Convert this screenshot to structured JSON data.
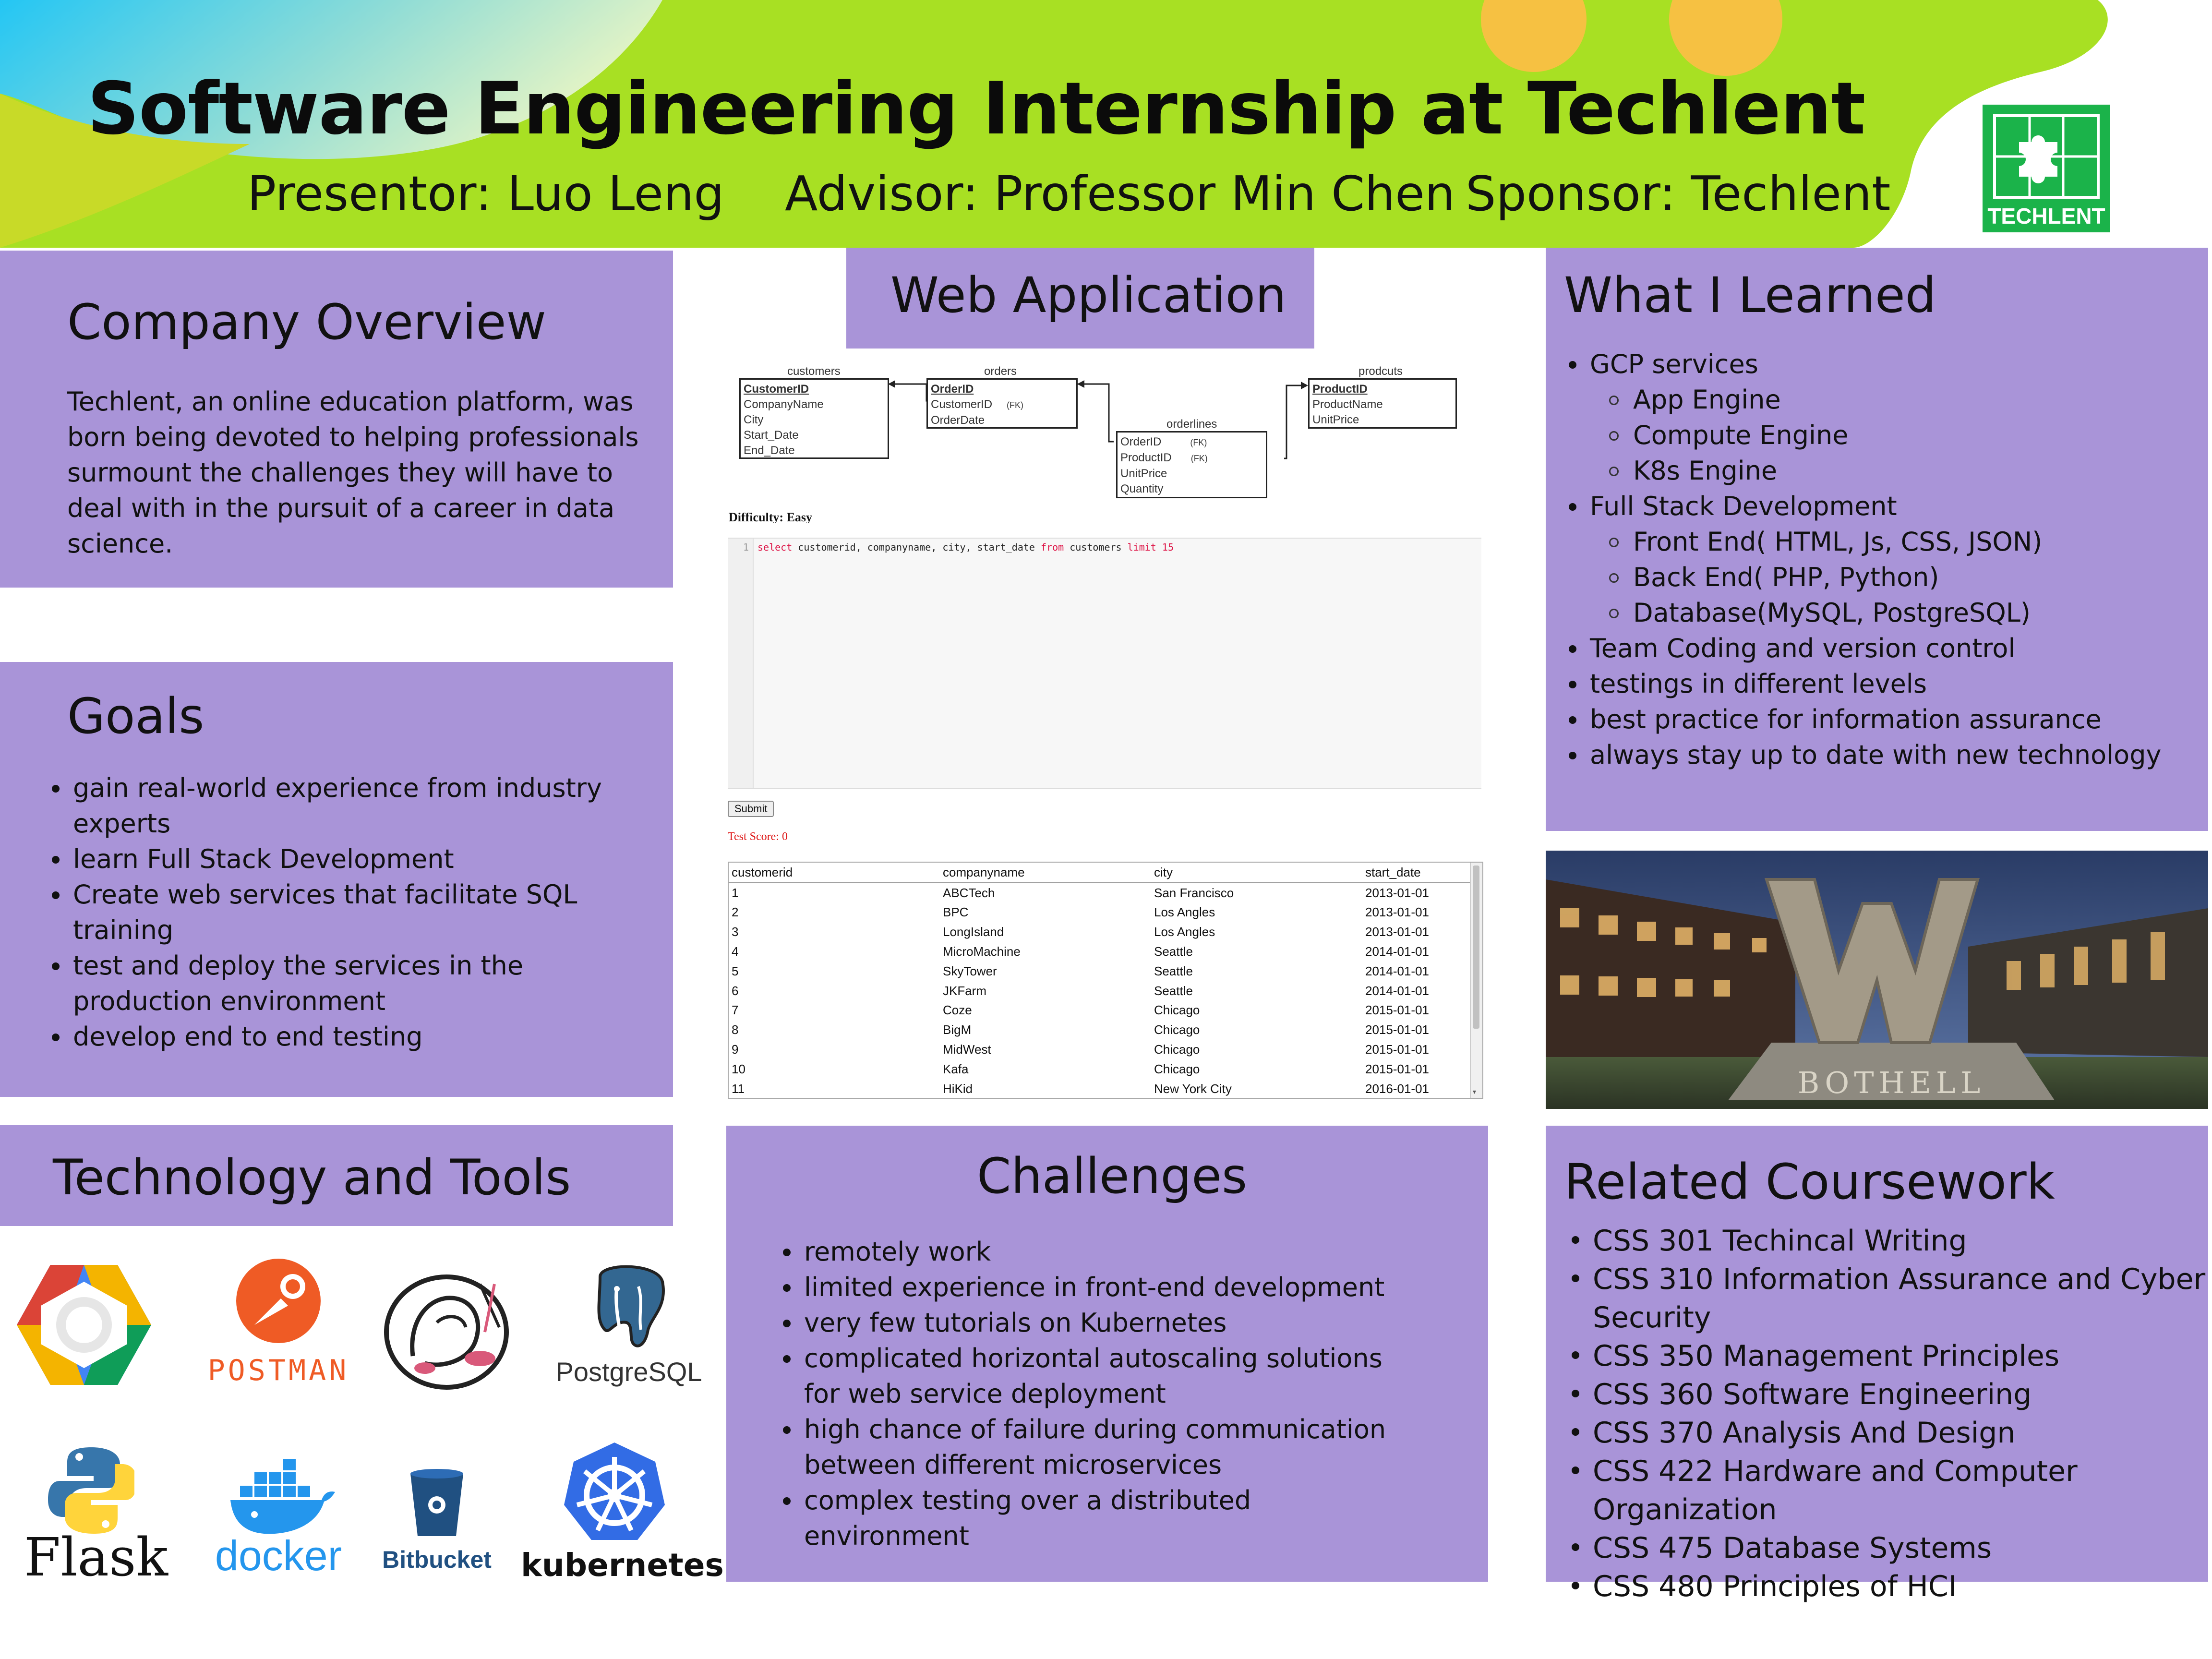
{
  "header": {
    "title": "Software Engineering Internship at Techlent",
    "presenter": "Presentor: Luo Leng",
    "advisor": "Advisor: Professor Min Chen",
    "sponsor": "Sponsor: Techlent",
    "logo_text": "TECHLENT"
  },
  "colors": {
    "panel": "#a994d8",
    "header_green": "#a8e023",
    "header_cyan": "#2ec4f0",
    "logo_green": "#1bb34a"
  },
  "company_overview": {
    "title": "Company Overview",
    "text": "Techlent, an online education platform, was born being devoted to helping professionals surmount the challenges they will have to deal with in the pursuit of a career in data science."
  },
  "goals": {
    "title": "Goals",
    "items": [
      "gain real-world experience from industry experts",
      "learn Full Stack Development",
      "Create web services that facilitate SQL training",
      "test and deploy the services in the production environment",
      "develop end to end testing"
    ]
  },
  "technology": {
    "title": "Technology and Tools",
    "logos": [
      "gcp-icon",
      "postman-icon",
      "sqlalchemy-icon",
      "postgresql-icon",
      "flask-icon",
      "docker-icon",
      "bitbucket-icon",
      "kubernetes-icon"
    ],
    "labels": {
      "postman": "POSTMAN",
      "postgres": "PostgreSQL",
      "flask": "Flask",
      "docker": "docker",
      "bitbucket": "Bitbucket",
      "kubernetes": "kubernetes"
    }
  },
  "web_app": {
    "title": "Web Application",
    "er": {
      "customers": {
        "name": "customers",
        "fields": [
          "CustomerID",
          "CompanyName",
          "City",
          "Start_Date",
          "End_Date"
        ]
      },
      "orders": {
        "name": "orders",
        "fields": [
          "OrderID",
          "CustomerID",
          "OrderDate"
        ]
      },
      "orderlines": {
        "name": "orderlines",
        "fields": [
          "OrderID",
          "ProductID",
          "UnitPrice",
          "Quantity"
        ]
      },
      "products": {
        "name": "prodcuts",
        "fields": [
          "ProductID",
          "ProductName",
          "UnitPrice"
        ]
      },
      "fk": "(FK)"
    },
    "difficulty": "Difficulty: Easy",
    "line_no": "1",
    "sql": {
      "k1": "select",
      "cols": " customerid, companyname, city, start_date ",
      "k2": "from",
      "tbl": " customers ",
      "k3": "limit",
      "num": " 15"
    },
    "submit": "Submit",
    "score": "Test Score: 0",
    "columns": [
      "customerid",
      "companyname",
      "city",
      "start_date"
    ],
    "rows": [
      [
        "1",
        "ABCTech",
        "San Francisco",
        "2013-01-01"
      ],
      [
        "2",
        "BPC",
        "Los Angles",
        "2013-01-01"
      ],
      [
        "3",
        "LongIsland",
        "Los Angles",
        "2013-01-01"
      ],
      [
        "4",
        "MicroMachine",
        "Seattle",
        "2014-01-01"
      ],
      [
        "5",
        "SkyTower",
        "Seattle",
        "2014-01-01"
      ],
      [
        "6",
        "JKFarm",
        "Seattle",
        "2014-01-01"
      ],
      [
        "7",
        "Coze",
        "Chicago",
        "2015-01-01"
      ],
      [
        "8",
        "BigM",
        "Chicago",
        "2015-01-01"
      ],
      [
        "9",
        "MidWest",
        "Chicago",
        "2015-01-01"
      ],
      [
        "10",
        "Kafa",
        "Chicago",
        "2015-01-01"
      ],
      [
        "11",
        "HiKid",
        "New York City",
        "2016-01-01"
      ]
    ]
  },
  "challenges": {
    "title": "Challenges",
    "items": [
      "remotely work",
      "limited experience in front-end development",
      "very few tutorials on Kubernetes",
      "complicated horizontal autoscaling solutions for web service deployment",
      "high chance of failure during communication between different microservices",
      "complex testing over a distributed environment"
    ]
  },
  "learned": {
    "title": "What I Learned",
    "items": [
      {
        "text": "GCP services",
        "level": 1
      },
      {
        "text": "App Engine",
        "level": 2
      },
      {
        "text": "Compute Engine",
        "level": 2
      },
      {
        "text": "K8s Engine",
        "level": 2
      },
      {
        "text": "Full Stack Development",
        "level": 1
      },
      {
        "text": "Front End( HTML, Js, CSS, JSON)",
        "level": 2
      },
      {
        "text": "Back End( PHP, Python)",
        "level": 2
      },
      {
        "text": "Database(MySQL, PostgreSQL)",
        "level": 2
      },
      {
        "text": "Team Coding and version control",
        "level": 1
      },
      {
        "text": "testings in different levels",
        "level": 1
      },
      {
        "text": "best practice for information assurance",
        "level": 1
      },
      {
        "text": "always stay up to date with new technology",
        "level": 1
      }
    ]
  },
  "photo": {
    "sign_text": "BOTHELL"
  },
  "coursework": {
    "title": "Related Coursework",
    "items": [
      "CSS 301 Techincal Writing",
      "CSS 310 Information Assurance and Cyber Security",
      "CSS 350 Management Principles",
      "CSS 360 Software Engineering",
      "CSS 370 Analysis And Design",
      "CSS 422 Hardware and Computer Organization",
      "CSS 475 Database Systems",
      "CSS 480 Principles of HCI"
    ]
  }
}
